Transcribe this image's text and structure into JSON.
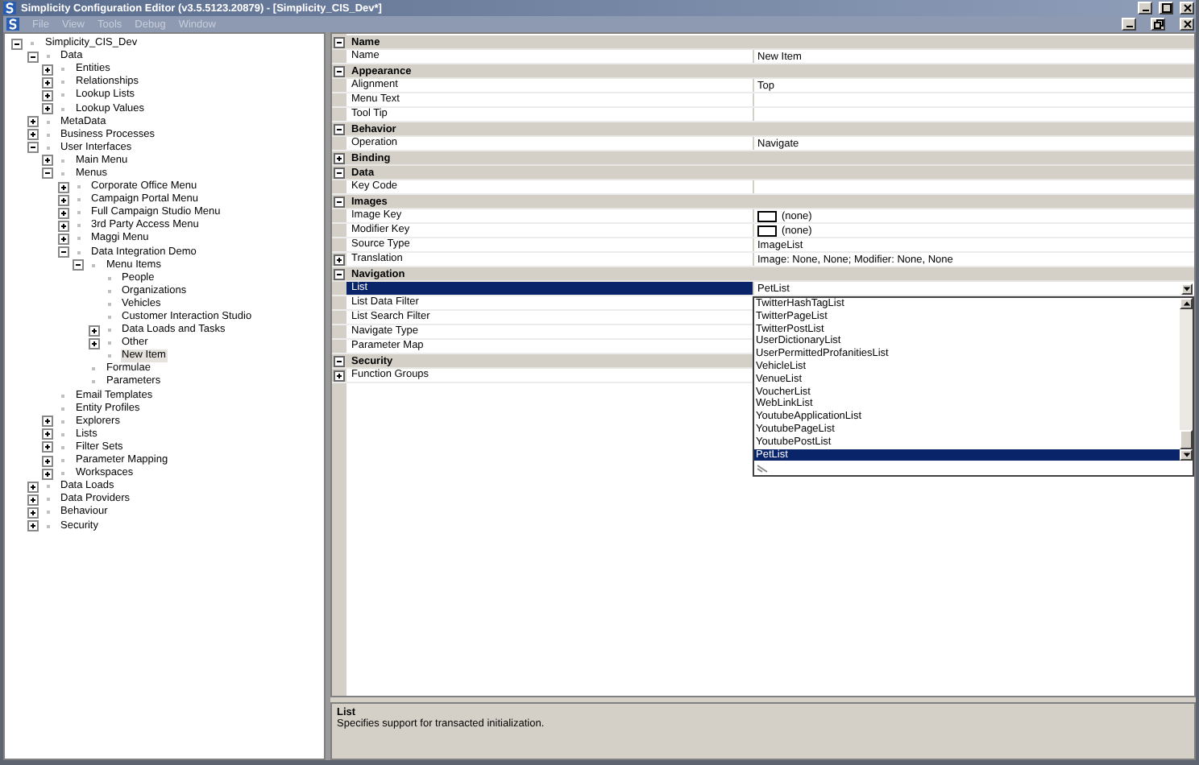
{
  "window": {
    "title": "Simplicity Configuration Editor (v3.5.5123.20879) - [Simplicity_CIS_Dev*]"
  },
  "menu": [
    "File",
    "View",
    "Tools",
    "Debug",
    "Window"
  ],
  "tree": [
    {
      "label": "Simplicity_CIS_Dev",
      "expanded": true,
      "selected": false,
      "children": [
        {
          "label": "Data",
          "expanded": true,
          "selected": false,
          "children": [
            {
              "label": "Entities",
              "expanded": false,
              "selected": false
            },
            {
              "label": "Relationships",
              "expanded": false,
              "selected": false
            },
            {
              "label": "Lookup Lists",
              "expanded": false,
              "selected": false
            },
            {
              "label": "Lookup Values",
              "expanded": false,
              "selected": false
            }
          ]
        },
        {
          "label": "MetaData",
          "expanded": false,
          "selected": false
        },
        {
          "label": "Business Processes",
          "expanded": false,
          "selected": false
        },
        {
          "label": "User Interfaces",
          "expanded": true,
          "selected": false,
          "children": [
            {
              "label": "Main Menu",
              "expanded": false,
              "selected": false
            },
            {
              "label": "Menus",
              "expanded": true,
              "selected": false,
              "children": [
                {
                  "label": "Corporate Office Menu",
                  "expanded": false,
                  "selected": false
                },
                {
                  "label": "Campaign Portal Menu",
                  "expanded": false,
                  "selected": false
                },
                {
                  "label": "Full Campaign Studio Menu",
                  "expanded": false,
                  "selected": false
                },
                {
                  "label": "3rd Party Access Menu",
                  "expanded": false,
                  "selected": false
                },
                {
                  "label": "Maggi Menu",
                  "expanded": false,
                  "selected": false
                },
                {
                  "label": "Data Integration Demo",
                  "expanded": true,
                  "selected": false,
                  "children": [
                    {
                      "label": "Menu Items",
                      "expanded": true,
                      "selected": false,
                      "children": [
                        {
                          "label": "People",
                          "selected": false
                        },
                        {
                          "label": "Organizations",
                          "selected": false
                        },
                        {
                          "label": "Vehicles",
                          "selected": false
                        },
                        {
                          "label": "Customer Interaction Studio",
                          "selected": false
                        },
                        {
                          "label": "Data Loads and Tasks",
                          "expanded": false,
                          "selected": false
                        },
                        {
                          "label": "Other",
                          "expanded": false,
                          "selected": false
                        },
                        {
                          "label": "New Item",
                          "selected": true
                        }
                      ]
                    },
                    {
                      "label": "Formulae",
                      "selected": false
                    },
                    {
                      "label": "Parameters",
                      "selected": false
                    }
                  ]
                }
              ]
            },
            {
              "label": "Email Templates",
              "selected": false
            },
            {
              "label": "Entity Profiles",
              "selected": false
            },
            {
              "label": "Explorers",
              "expanded": false,
              "selected": false
            },
            {
              "label": "Lists",
              "expanded": false,
              "selected": false
            },
            {
              "label": "Filter Sets",
              "expanded": false,
              "selected": false
            },
            {
              "label": "Parameter Mapping",
              "expanded": false,
              "selected": false
            },
            {
              "label": "Workspaces",
              "expanded": false,
              "selected": false
            }
          ]
        },
        {
          "label": "Data Loads",
          "expanded": false,
          "selected": false
        },
        {
          "label": "Data Providers",
          "expanded": false,
          "selected": false
        },
        {
          "label": "Behaviour",
          "expanded": false,
          "selected": false
        },
        {
          "label": "Security",
          "expanded": false,
          "selected": false
        }
      ]
    }
  ],
  "properties": [
    {
      "category": "Name",
      "expanded": true,
      "rows": [
        {
          "name": "Name",
          "value": "New Item",
          "selected": false
        }
      ]
    },
    {
      "category": "Appearance",
      "expanded": true,
      "rows": [
        {
          "name": "Alignment",
          "value": "Top",
          "selected": false
        },
        {
          "name": "Menu Text",
          "selected": false
        },
        {
          "name": "Tool Tip",
          "selected": false
        }
      ]
    },
    {
      "category": "Behavior",
      "expanded": true,
      "rows": [
        {
          "name": "Operation",
          "value": "Navigate",
          "selected": false
        }
      ]
    },
    {
      "category": "Binding",
      "expanded": false
    },
    {
      "category": "Data",
      "expanded": true,
      "rows": [
        {
          "name": "Key Code",
          "selected": false
        }
      ]
    },
    {
      "category": "Images",
      "expanded": true,
      "rows": [
        {
          "name": "Image Key",
          "value": "(none)",
          "kind": "swatch",
          "selected": false
        },
        {
          "name": "Modifier Key",
          "value": "(none)",
          "kind": "swatch",
          "selected": false
        },
        {
          "name": "Source Type",
          "value": "ImageList",
          "selected": false
        },
        {
          "name": "Translation",
          "value": "Image: None, None; Modifier: None, None",
          "expanded": false,
          "selected": false
        }
      ]
    },
    {
      "category": "Navigation",
      "expanded": true,
      "rows": [
        {
          "name": "List",
          "value": "PetList",
          "kind": "dropdown",
          "selected": true
        },
        {
          "name": "List Data Filter",
          "selected": false
        },
        {
          "name": "List Search Filter",
          "selected": false
        },
        {
          "name": "Navigate Type",
          "selected": false
        },
        {
          "name": "Parameter Map",
          "selected": false
        }
      ]
    },
    {
      "category": "Security",
      "expanded": true,
      "rows": [
        {
          "name": "Function Groups",
          "expanded": false,
          "selected": false
        }
      ]
    }
  ],
  "dropdown": {
    "items": [
      {
        "label": "TwitterHashTagList",
        "selected": false
      },
      {
        "label": "TwitterPageList",
        "selected": false
      },
      {
        "label": "TwitterPostList",
        "selected": false
      },
      {
        "label": "UserDictionaryList",
        "selected": false
      },
      {
        "label": "UserPermittedProfanitiesList",
        "selected": false
      },
      {
        "label": "VehicleList",
        "selected": false
      },
      {
        "label": "VenueList",
        "selected": false
      },
      {
        "label": "VoucherList",
        "selected": false
      },
      {
        "label": "WebLinkList",
        "selected": false
      },
      {
        "label": "YoutubeApplicationList",
        "selected": false
      },
      {
        "label": "YoutubePageList",
        "selected": false
      },
      {
        "label": "YoutubePostList",
        "selected": false
      },
      {
        "label": "PetList",
        "selected": true
      }
    ]
  },
  "description": {
    "title": "List",
    "text": "Specifies support for transacted initialization."
  }
}
